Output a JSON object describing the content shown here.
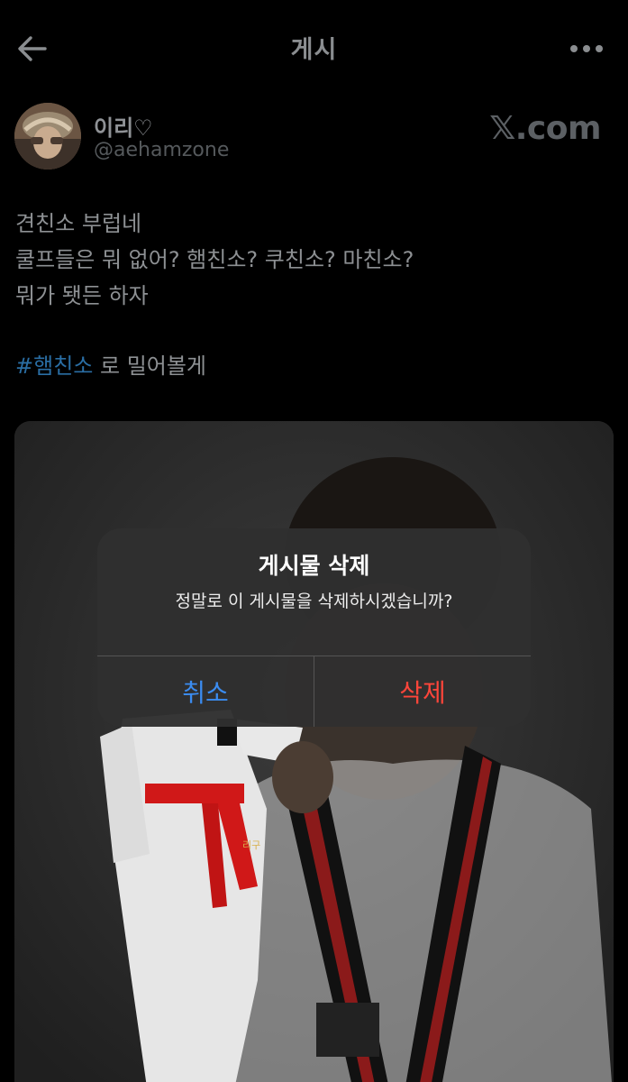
{
  "header": {
    "title": "게시",
    "back_icon": "arrow-left-icon",
    "more_icon": "more-horizontal-icon"
  },
  "post": {
    "author": {
      "display_name": "이리♡",
      "handle": "@aehamzone"
    },
    "source": "𝕏.com",
    "body_lines": [
      "견친소 부럽네",
      "쿨프들은 뭐 없어? 햄친소? 쿠친소? 마친소?",
      "뭐가 됏든 하자"
    ],
    "hashtag": "#햄친소",
    "hashtag_suffix": " 로 밀어볼게",
    "belt_text": "리구"
  },
  "alert": {
    "title": "게시물 삭제",
    "message": "정말로 이 게시물을 삭제하시겠습니까?",
    "cancel_label": "취소",
    "delete_label": "삭제"
  },
  "colors": {
    "background": "#000000",
    "hashtag": "#2a6ea4",
    "cancel": "#3b8cf0",
    "destructive": "#ff453a",
    "alert_bg": "#303030"
  }
}
